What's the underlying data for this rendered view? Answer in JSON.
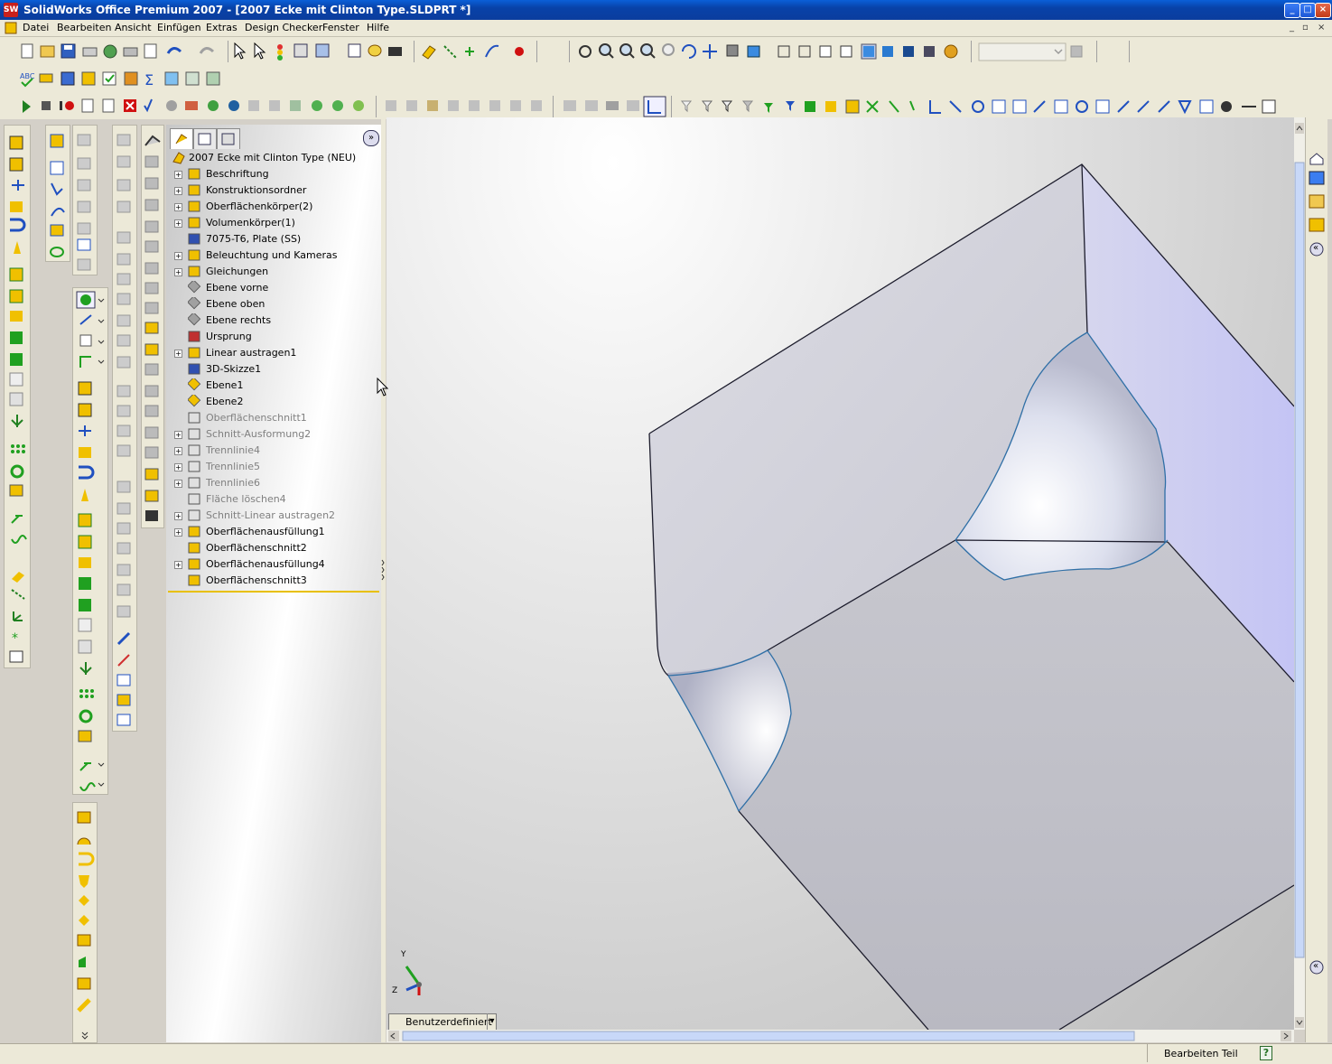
{
  "window": {
    "title": "SolidWorks Office Premium 2007 - [2007 Ecke mit Clinton Type.SLDPRT *]",
    "app_icon": "SW",
    "controls": [
      "_",
      "□",
      "×"
    ]
  },
  "menu": [
    "Datei",
    "Bearbeiten",
    "Ansicht",
    "Einfügen",
    "Extras",
    "Design Checker",
    "Fenster",
    "Hilfe"
  ],
  "mdi_controls": [
    "_",
    "▫",
    "×"
  ],
  "feature_manager": {
    "root": "2007 Ecke mit Clinton Type  (NEU)",
    "collapse_label": "»",
    "items": [
      {
        "label": "Beschriftung",
        "expand": true,
        "dim": false,
        "icon": "annotation-icon",
        "color": "#f0c000"
      },
      {
        "label": "Konstruktionsordner",
        "expand": true,
        "dim": false,
        "icon": "design-binder-icon",
        "color": "#f0c000"
      },
      {
        "label": "Oberflächenkörper(2)",
        "expand": true,
        "dim": false,
        "icon": "surface-bodies-icon",
        "color": "#f0c000"
      },
      {
        "label": "Volumenkörper(1)",
        "expand": true,
        "dim": false,
        "icon": "solid-bodies-icon",
        "color": "#f0c000"
      },
      {
        "label": "7075-T6, Plate (SS)",
        "expand": false,
        "dim": false,
        "icon": "material-icon",
        "color": "#3050b0"
      },
      {
        "label": "Beleuchtung und Kameras",
        "expand": true,
        "dim": false,
        "icon": "lights-cameras-icon",
        "color": "#f0c000"
      },
      {
        "label": "Gleichungen",
        "expand": true,
        "dim": false,
        "icon": "equations-icon",
        "color": "#f0c000"
      },
      {
        "label": "Ebene vorne",
        "expand": false,
        "dim": false,
        "icon": "plane-icon",
        "color": "#a0a0a0"
      },
      {
        "label": "Ebene oben",
        "expand": false,
        "dim": false,
        "icon": "plane-icon",
        "color": "#a0a0a0"
      },
      {
        "label": "Ebene rechts",
        "expand": false,
        "dim": false,
        "icon": "plane-icon",
        "color": "#a0a0a0"
      },
      {
        "label": "Ursprung",
        "expand": false,
        "dim": false,
        "icon": "origin-icon",
        "color": "#c03030"
      },
      {
        "label": "Linear austragen1",
        "expand": true,
        "dim": false,
        "icon": "extrude-icon",
        "color": "#f0c000"
      },
      {
        "label": "3D-Skizze1",
        "expand": false,
        "dim": false,
        "icon": "3d-sketch-icon",
        "color": "#3050b0"
      },
      {
        "label": "Ebene1",
        "expand": false,
        "dim": false,
        "icon": "plane-icon",
        "color": "#f0c000"
      },
      {
        "label": "Ebene2",
        "expand": false,
        "dim": false,
        "icon": "plane-icon",
        "color": "#f0c000"
      },
      {
        "label": "Oberflächenschnitt1",
        "expand": false,
        "dim": true,
        "icon": "surface-cut-icon",
        "color": "#a0a0a0"
      },
      {
        "label": "Schnitt-Ausformung2",
        "expand": true,
        "dim": true,
        "icon": "cut-loft-icon",
        "color": "#a0a0a0"
      },
      {
        "label": "Trennlinie4",
        "expand": true,
        "dim": true,
        "icon": "split-line-icon",
        "color": "#a0a0a0"
      },
      {
        "label": "Trennlinie5",
        "expand": true,
        "dim": true,
        "icon": "split-line-icon",
        "color": "#a0a0a0"
      },
      {
        "label": "Trennlinie6",
        "expand": true,
        "dim": true,
        "icon": "split-line-icon",
        "color": "#a0a0a0"
      },
      {
        "label": "Fläche löschen4",
        "expand": false,
        "dim": true,
        "icon": "delete-face-icon",
        "color": "#a0a0a0"
      },
      {
        "label": "Schnitt-Linear austragen2",
        "expand": true,
        "dim": true,
        "icon": "cut-extrude-icon",
        "color": "#a0a0a0"
      },
      {
        "label": "Oberflächenausfüllung1",
        "expand": true,
        "dim": false,
        "icon": "fill-surface-icon",
        "color": "#f0c000"
      },
      {
        "label": "Oberflächenschnitt2",
        "expand": false,
        "dim": false,
        "icon": "surface-cut-icon",
        "color": "#f0c000"
      },
      {
        "label": "Oberflächenausfüllung4",
        "expand": true,
        "dim": false,
        "icon": "fill-surface-icon",
        "color": "#f0c000"
      },
      {
        "label": "Oberflächenschnitt3",
        "expand": false,
        "dim": false,
        "icon": "surface-cut-icon",
        "color": "#f0c000"
      }
    ]
  },
  "viewport": {
    "view_selector": "Benutzerdefiniert",
    "view_selector_arrow": "▾",
    "triad": {
      "x": "",
      "y": "Y",
      "z": "Z"
    }
  },
  "taskpane": {
    "collapse": "«",
    "expand": "«"
  },
  "status": {
    "text": "Bearbeiten Teil",
    "help": "?"
  },
  "colors": {
    "title_bar": "#0842a8",
    "part_face_light": "#d9d9e6",
    "part_face_blue": "#c8c8f0",
    "edge": "#1c1c2c",
    "highlight_edge": "#2f6fa6"
  }
}
